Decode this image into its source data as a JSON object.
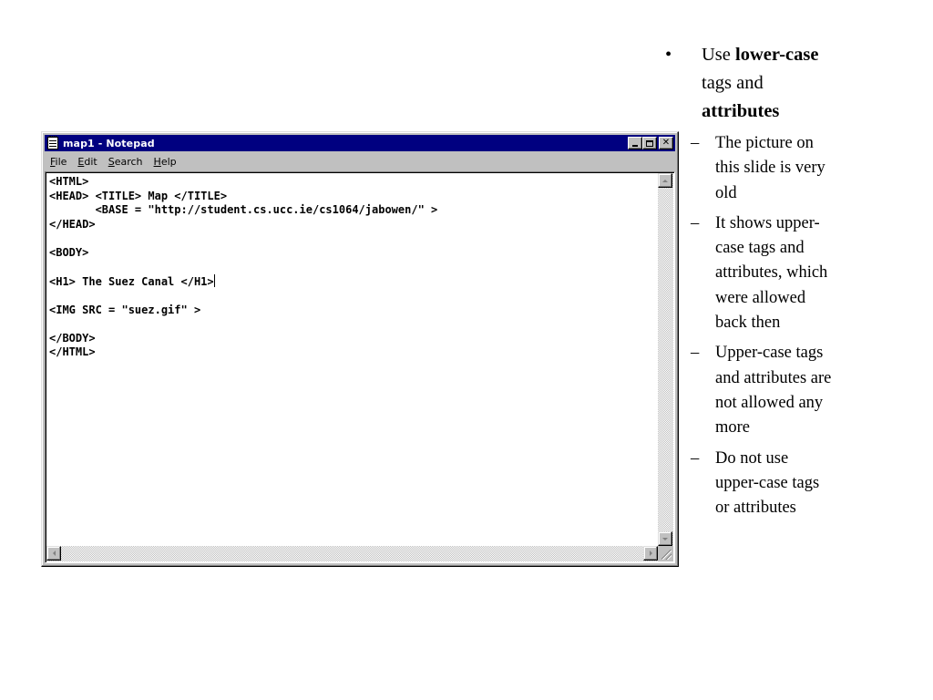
{
  "window": {
    "title": "map1 - Notepad",
    "menu": [
      "File",
      "Edit",
      "Search",
      "Help"
    ],
    "menu_underline": [
      "F",
      "E",
      "S",
      "H"
    ],
    "lines": [
      "<HTML>",
      "<HEAD> <TITLE> Map </TITLE>",
      "       <BASE = \"http://student.cs.ucc.ie/cs1064/jabowen/\" >",
      "</HEAD>",
      "",
      "<BODY>",
      "",
      "<H1> The Suez Canal </H1>",
      "",
      "<IMG SRC = \"suez.gif\" >",
      "",
      "</BODY>",
      "</HTML>"
    ],
    "caret_line": 7,
    "colors": {
      "titlebar": "#000080",
      "chrome": "#c0c0c0"
    }
  },
  "slide": {
    "bullet_symbol": "•",
    "dash_symbol": "–",
    "main": {
      "prefix": "Use",
      "bold1": "lower-case",
      "middle": "tags and",
      "bold2": "attributes"
    },
    "subs": [
      "The picture on this slide is very old",
      "It shows upper-case tags and attributes, which were allowed back then",
      "Upper-case tags and attributes are not allowed any more",
      "Do not use upper-case tags or attributes"
    ]
  }
}
